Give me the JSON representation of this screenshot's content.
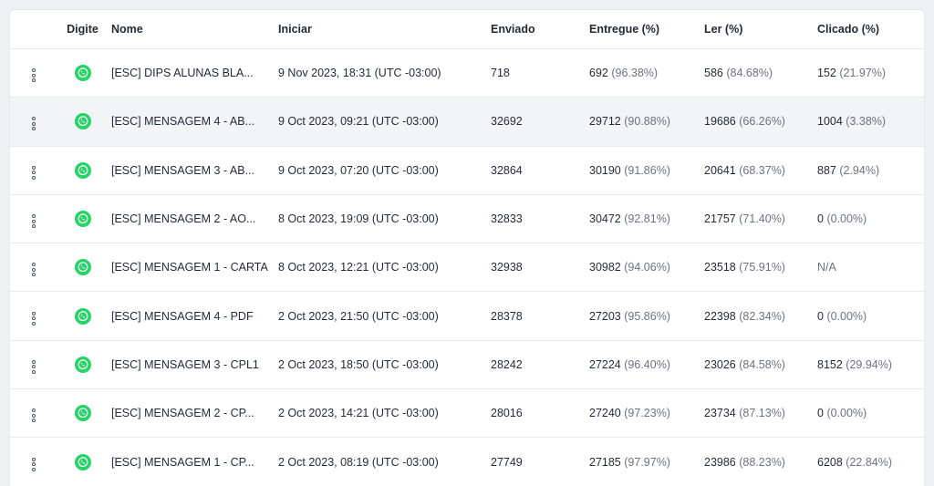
{
  "columns": {
    "type": "Digite",
    "name": "Nome",
    "start": "Iniciar",
    "sent": "Enviado",
    "delivered": "Entregue (%)",
    "read": "Ler (%)",
    "clicked": "Clicado (%)"
  },
  "icons": {
    "row_menu": "vertical-dots-icon",
    "channel": "whatsapp-icon"
  },
  "colors": {
    "whatsapp": "#25D366",
    "row_highlight": "#f3f4f6"
  },
  "rows": [
    {
      "name": "[ESC] DIPS ALUNAS BLA...",
      "start": "9 Nov 2023, 18:31 (UTC -03:00)",
      "sent": "718",
      "delivered": "692",
      "delivered_pct": "(96.38%)",
      "read": "586",
      "read_pct": "(84.68%)",
      "clicked": "152",
      "clicked_pct": "(21.97%)"
    },
    {
      "name": "[ESC] MENSAGEM 4 - AB...",
      "start": "9 Oct 2023, 09:21 (UTC -03:00)",
      "sent": "32692",
      "delivered": "29712",
      "delivered_pct": "(90.88%)",
      "read": "19686",
      "read_pct": "(66.26%)",
      "clicked": "1004",
      "clicked_pct": "(3.38%)"
    },
    {
      "name": "[ESC] MENSAGEM 3 - AB...",
      "start": "9 Oct 2023, 07:20 (UTC -03:00)",
      "sent": "32864",
      "delivered": "30190",
      "delivered_pct": "(91.86%)",
      "read": "20641",
      "read_pct": "(68.37%)",
      "clicked": "887",
      "clicked_pct": "(2.94%)"
    },
    {
      "name": "[ESC] MENSAGEM 2 - AO...",
      "start": "8 Oct 2023, 19:09 (UTC -03:00)",
      "sent": "32833",
      "delivered": "30472",
      "delivered_pct": "(92.81%)",
      "read": "21757",
      "read_pct": "(71.40%)",
      "clicked": "0",
      "clicked_pct": "(0.00%)"
    },
    {
      "name": "[ESC] MENSAGEM 1 - CARTA",
      "start": "8 Oct 2023, 12:21 (UTC -03:00)",
      "sent": "32938",
      "delivered": "30982",
      "delivered_pct": "(94.06%)",
      "read": "23518",
      "read_pct": "(75.91%)",
      "clicked": "N/A",
      "clicked_pct": ""
    },
    {
      "name": "[ESC] MENSAGEM 4 - PDF",
      "start": "2 Oct 2023, 21:50 (UTC -03:00)",
      "sent": "28378",
      "delivered": "27203",
      "delivered_pct": "(95.86%)",
      "read": "22398",
      "read_pct": "(82.34%)",
      "clicked": "0",
      "clicked_pct": "(0.00%)"
    },
    {
      "name": "[ESC] MENSAGEM 3 - CPL1",
      "start": "2 Oct 2023, 18:50 (UTC -03:00)",
      "sent": "28242",
      "delivered": "27224",
      "delivered_pct": "(96.40%)",
      "read": "23026",
      "read_pct": "(84.58%)",
      "clicked": "8152",
      "clicked_pct": "(29.94%)"
    },
    {
      "name": "[ESC] MENSAGEM 2 - CP...",
      "start": "2 Oct 2023, 14:21 (UTC -03:00)",
      "sent": "28016",
      "delivered": "27240",
      "delivered_pct": "(97.23%)",
      "read": "23734",
      "read_pct": "(87.13%)",
      "clicked": "0",
      "clicked_pct": "(0.00%)"
    },
    {
      "name": "[ESC] MENSAGEM 1 - CP...",
      "start": "2 Oct 2023, 08:19 (UTC -03:00)",
      "sent": "27749",
      "delivered": "27185",
      "delivered_pct": "(97.97%)",
      "read": "23986",
      "read_pct": "(88.23%)",
      "clicked": "6208",
      "clicked_pct": "(22.84%)"
    }
  ]
}
